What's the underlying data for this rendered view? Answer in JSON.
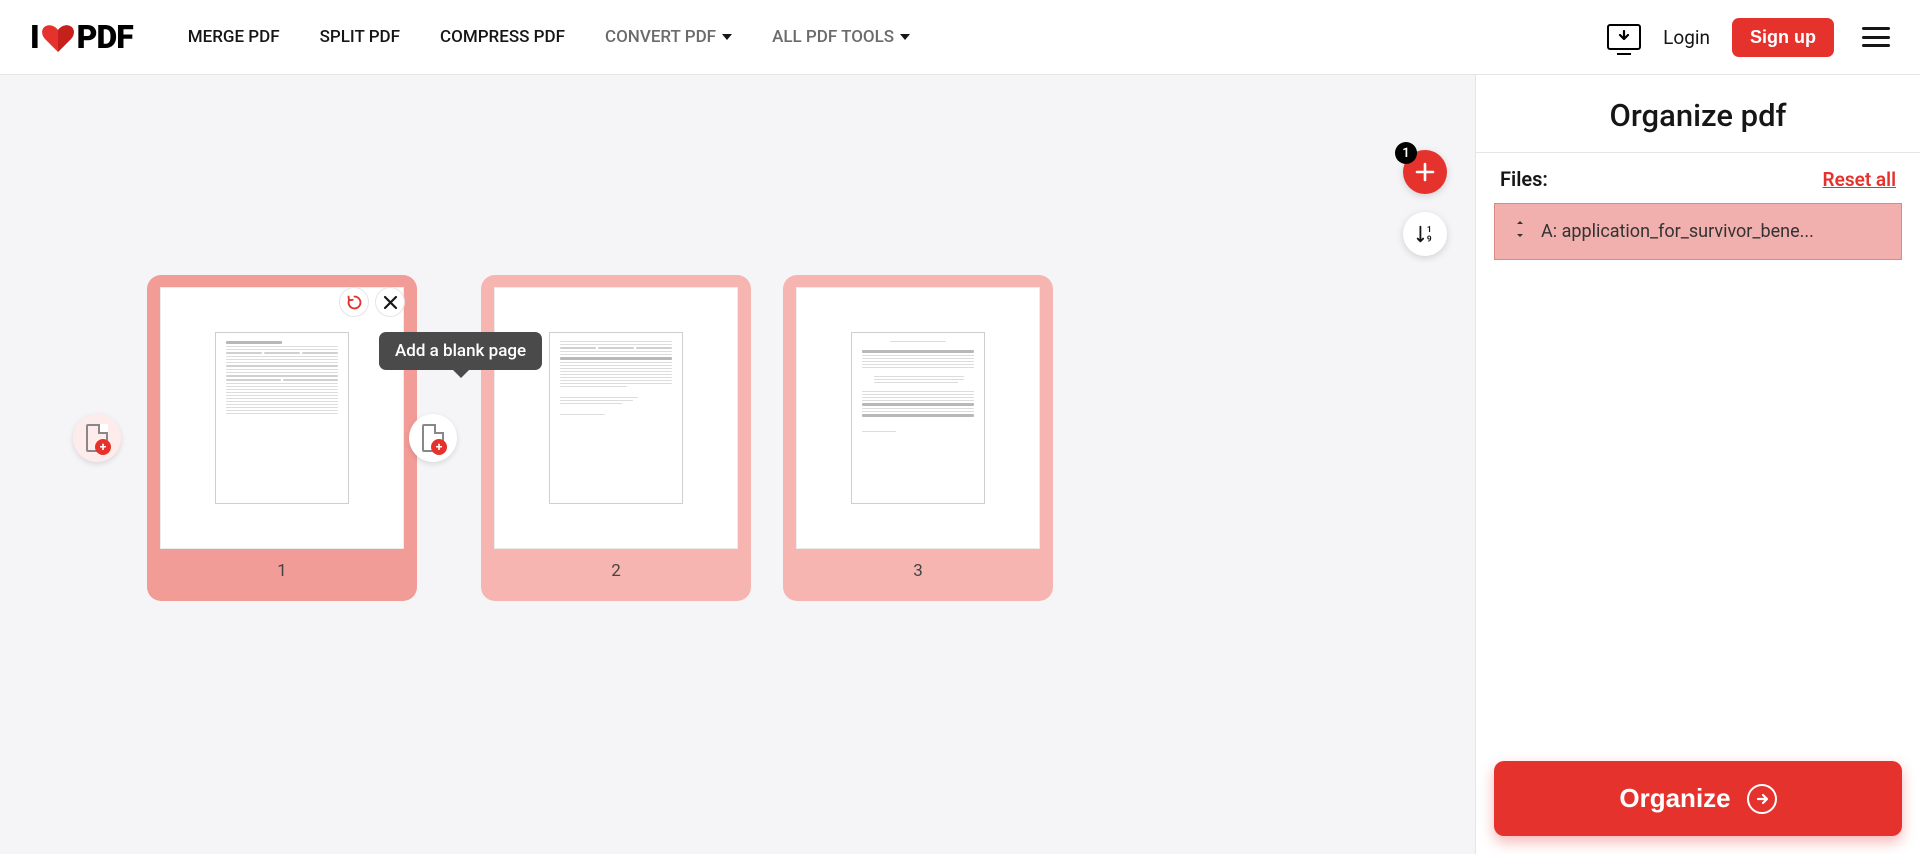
{
  "logo": {
    "left": "I",
    "right": "PDF"
  },
  "nav": {
    "merge": "MERGE PDF",
    "split": "SPLIT PDF",
    "compress": "COMPRESS PDF",
    "convert": "CONVERT PDF",
    "all": "ALL PDF TOOLS"
  },
  "header": {
    "login": "Login",
    "signup": "Sign up"
  },
  "fab": {
    "badge": "1"
  },
  "tooltip": {
    "add_blank": "Add a blank page"
  },
  "pages": [
    {
      "num": "1"
    },
    {
      "num": "2"
    },
    {
      "num": "3"
    }
  ],
  "sidebar": {
    "title": "Organize pdf",
    "files_label": "Files:",
    "reset": "Reset all",
    "file_a": "A: application_for_survivor_bene...",
    "organize": "Organize"
  }
}
